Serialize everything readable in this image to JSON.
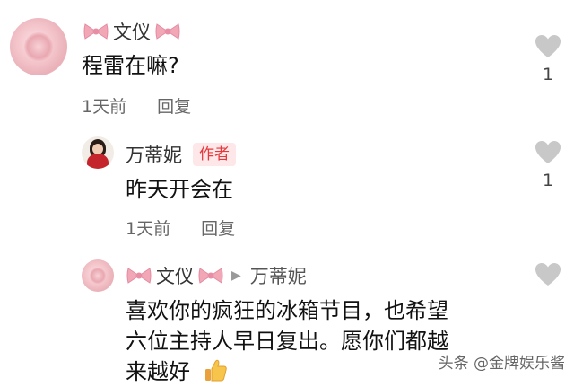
{
  "comments": [
    {
      "user": "文仪",
      "text": "程雷在嘛?",
      "time": "1天前",
      "reply_label": "回复",
      "like_count": "1"
    },
    {
      "user": "万蒂妮",
      "badge": "作者",
      "text": "昨天开会在",
      "time": "1天前",
      "reply_label": "回复",
      "like_count": "1"
    },
    {
      "user": "文仪",
      "reply_to": "万蒂妮",
      "text_lines": [
        "喜欢你的疯狂的冰箱节目，也希望",
        "六位主持人早日复出。愿你们都越",
        "来越好"
      ],
      "emoji": "thumbs-up"
    }
  ],
  "watermark": "头条 @金牌娱乐酱",
  "colors": {
    "bow": "#f2a7b7",
    "badge_text": "#e4393c",
    "badge_bg": "#fde7e8",
    "heart": "#c8c8c8"
  }
}
